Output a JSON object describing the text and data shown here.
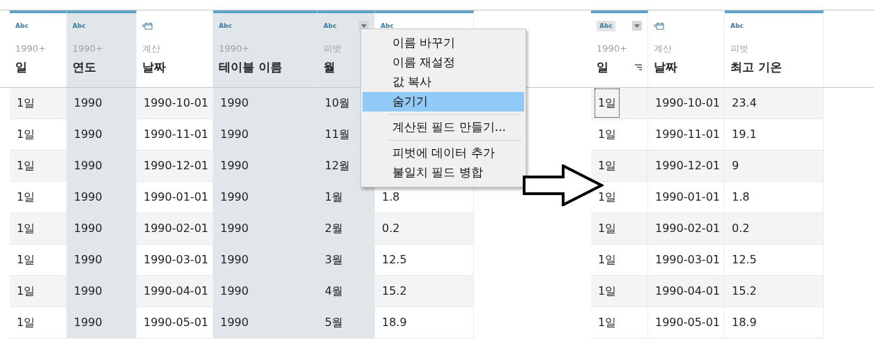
{
  "left_grid": {
    "columns": [
      {
        "kind": "text",
        "type_label": "Abc",
        "source": "1990+",
        "name": "일",
        "selected": false,
        "dropdown": false
      },
      {
        "kind": "text",
        "type_label": "Abc",
        "source": "1990+",
        "name": "연도",
        "selected": true,
        "dropdown": false
      },
      {
        "kind": "date",
        "source": "계산",
        "name": "날짜",
        "selected": false,
        "dropdown": false
      },
      {
        "kind": "text",
        "type_label": "Abc",
        "source": "1990+",
        "name": "테이블 이름",
        "selected": true,
        "dropdown": false
      },
      {
        "kind": "text",
        "type_label": "Abc",
        "source": "피벗",
        "name": "월",
        "selected": true,
        "dropdown": true
      },
      {
        "kind": "text",
        "type_label": "Abc",
        "selected": false,
        "dropdown": false
      }
    ],
    "rows": [
      [
        "1일",
        "1990",
        "1990-10-01",
        "1990",
        "10월"
      ],
      [
        "1일",
        "1990",
        "1990-11-01",
        "1990",
        "11월"
      ],
      [
        "1일",
        "1990",
        "1990-12-01",
        "1990",
        "12월"
      ],
      [
        "1일",
        "1990",
        "1990-01-01",
        "1990",
        "1월",
        "1.8"
      ],
      [
        "1일",
        "1990",
        "1990-02-01",
        "1990",
        "2월",
        "0.2"
      ],
      [
        "1일",
        "1990",
        "1990-03-01",
        "1990",
        "3월",
        "12.5"
      ],
      [
        "1일",
        "1990",
        "1990-04-01",
        "1990",
        "4월",
        "15.2"
      ],
      [
        "1일",
        "1990",
        "1990-05-01",
        "1990",
        "5월",
        "18.9"
      ]
    ]
  },
  "context_menu": {
    "items": [
      {
        "kind": "item",
        "label": "이름 바꾸기",
        "selected": false
      },
      {
        "kind": "item",
        "label": "이름 재설정",
        "selected": false
      },
      {
        "kind": "item",
        "label": "값 복사",
        "selected": false
      },
      {
        "kind": "item",
        "label": "숨기기",
        "selected": true
      },
      {
        "kind": "separator"
      },
      {
        "kind": "item",
        "label": "계산된 필드 만들기...",
        "selected": false
      },
      {
        "kind": "separator"
      },
      {
        "kind": "item",
        "label": "피벗에 데이터 추가",
        "selected": false
      },
      {
        "kind": "item",
        "label": "불일치 필드 병합",
        "selected": false
      }
    ]
  },
  "right_grid": {
    "columns": [
      {
        "kind": "text",
        "type_label": "Abc",
        "source": "1990+",
        "name": "일",
        "dropdown": true,
        "sorted": true
      },
      {
        "kind": "date",
        "source": "계산",
        "name": "날짜",
        "dropdown": false,
        "sorted": false
      },
      {
        "kind": "text",
        "type_label": "Abc",
        "source": "피벗",
        "name": "최고 기온",
        "dropdown": false,
        "sorted": false
      }
    ],
    "rows": [
      {
        "cells": [
          "1일",
          "1990-10-01",
          "23.4"
        ],
        "first_cell_focused": true
      },
      {
        "cells": [
          "1일",
          "1990-11-01",
          "19.1"
        ],
        "first_cell_focused": false
      },
      {
        "cells": [
          "1일",
          "1990-12-01",
          "9"
        ],
        "first_cell_focused": false
      },
      {
        "cells": [
          "1일",
          "1990-01-01",
          "1.8"
        ],
        "first_cell_focused": false
      },
      {
        "cells": [
          "1일",
          "1990-02-01",
          "0.2"
        ],
        "first_cell_focused": false
      },
      {
        "cells": [
          "1일",
          "1990-03-01",
          "12.5"
        ],
        "first_cell_focused": false
      },
      {
        "cells": [
          "1일",
          "1990-04-01",
          "15.2"
        ],
        "first_cell_focused": false
      },
      {
        "cells": [
          "1일",
          "1990-05-01",
          "18.9"
        ],
        "first_cell_focused": false
      }
    ]
  }
}
